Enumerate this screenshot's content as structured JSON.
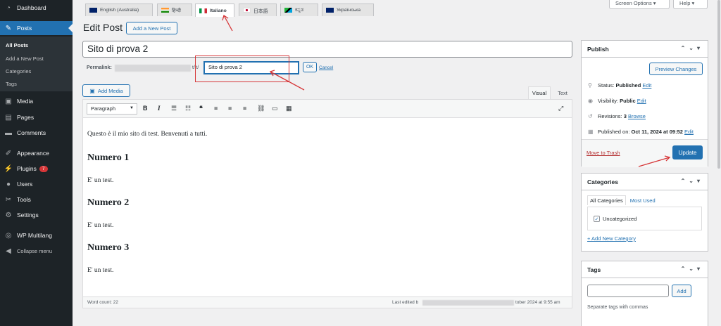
{
  "sidebar": {
    "dashboard": "Dashboard",
    "posts": "Posts",
    "submenu": [
      "All Posts",
      "Add a New Post",
      "Categories",
      "Tags"
    ],
    "media": "Media",
    "pages": "Pages",
    "comments": "Comments",
    "appearance": "Appearance",
    "plugins": "Plugins",
    "plugins_badge": "7",
    "users": "Users",
    "tools": "Tools",
    "settings": "Settings",
    "wp_multilang": "WP Multilang",
    "collapse": "Collapse menu"
  },
  "language_tabs": [
    {
      "label": "English (Australia)",
      "flag": "au"
    },
    {
      "label": "हिन्दी",
      "flag": "in"
    },
    {
      "label": "Italiano",
      "flag": "it"
    },
    {
      "label": "日本語",
      "flag": "jp"
    },
    {
      "label": "ಕನ್ನಡ",
      "flag": "tz"
    },
    {
      "label": "Українська",
      "flag": "gb"
    }
  ],
  "top_buttons": {
    "screen_options": "Screen Options ▾",
    "help": "Help ▾"
  },
  "page": {
    "title": "Edit Post",
    "add_new": "Add a New Post"
  },
  "post": {
    "title": "Sito di prova 2",
    "permalink_label": "Permalink:",
    "permalink_mid": "t/it/",
    "slug": "Sito di prova 2",
    "ok": "OK",
    "cancel": "Cancel"
  },
  "editor": {
    "add_media": "Add Media",
    "tab_visual": "Visual",
    "tab_text": "Text",
    "format": "Paragraph",
    "content": {
      "p1": "Questo è il mio sito di test. Benvenuti a tutti.",
      "h1": "Numero 1",
      "p2": "E' un test.",
      "h2": "Numero 2",
      "p3": "E' un test.",
      "h3": "Numero 3",
      "p4": "E' un test."
    },
    "word_count": "Word count: 22",
    "last_edited_prefix": "Last edited b",
    "last_edited_suffix": "tober 2024 at 9:55 am"
  },
  "publish": {
    "title": "Publish",
    "preview": "Preview Changes",
    "status_label": "Status:",
    "status_value": "Published",
    "visibility_label": "Visibility:",
    "visibility_value": "Public",
    "revisions_label": "Revisions:",
    "revisions_value": "3",
    "browse": "Browse",
    "published_on_label": "Published on:",
    "published_on_value": "Oct 11, 2024 at 09:52",
    "edit": "Edit",
    "trash": "Move to Trash",
    "update": "Update"
  },
  "categories": {
    "title": "Categories",
    "tab_all": "All Categories",
    "tab_used": "Most Used",
    "item": "Uncategorized",
    "add_new": "+ Add New Category"
  },
  "tags": {
    "title": "Tags",
    "add": "Add",
    "help": "Separate tags with commas"
  },
  "colors": {
    "accent": "#2271b1",
    "sidebar": "#1d2327",
    "annotation": "#d63638"
  }
}
